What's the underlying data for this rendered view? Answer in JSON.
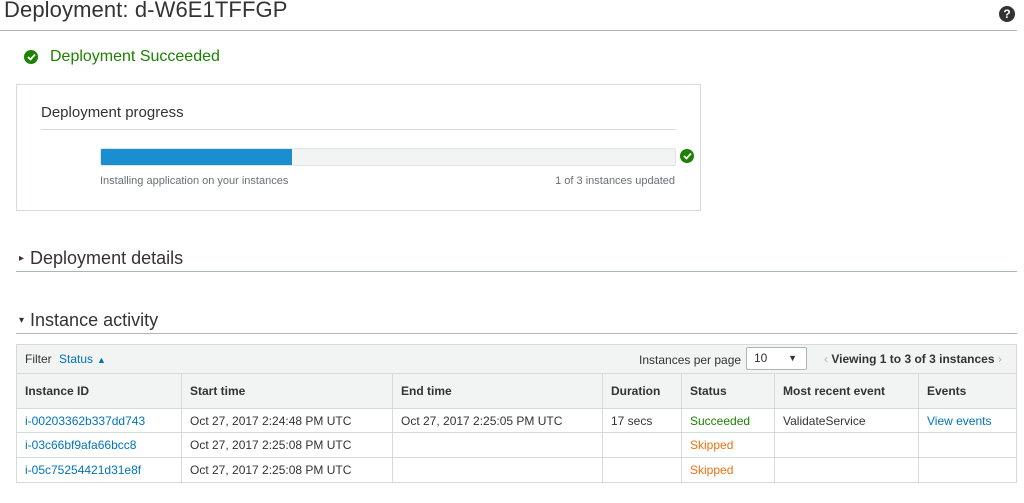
{
  "page": {
    "title": "Deployment: d-W6E1TFFGP",
    "help_icon": "?"
  },
  "status_banner": {
    "text": "Deployment Succeeded",
    "icon": "check-circle-icon",
    "color": "#1d8102"
  },
  "progress": {
    "title": "Deployment progress",
    "fraction": 0.333,
    "caption_left": "Installing application on your instances",
    "caption_right": "1 of 3 instances updated",
    "bar_color": "#1b8ed1"
  },
  "sections": {
    "details": {
      "caret": "▸",
      "label": "Deployment details"
    },
    "activity": {
      "caret": "▾",
      "label": "Instance activity"
    }
  },
  "filter": {
    "label": "Filter",
    "link": "Status",
    "chevron": "▲"
  },
  "pagination": {
    "per_page_label": "Instances per page",
    "per_page_value": "10",
    "prev": "‹",
    "viewing": "Viewing 1 to 3 of 3 instances",
    "next": "›"
  },
  "table": {
    "headers": [
      "Instance ID",
      "Start time",
      "End time",
      "Duration",
      "Status",
      "Most recent event",
      "Events"
    ],
    "rows": [
      [
        "i-00203362b337dd743",
        "Oct 27, 2017 2:24:48 PM UTC",
        "Oct 27, 2017 2:25:05 PM UTC",
        "17 secs",
        "Succeeded",
        "ValidateService",
        "View events"
      ],
      [
        "i-03c66bf9afa66bcc8",
        "Oct 27, 2017 2:25:08 PM UTC",
        "",
        "",
        "Skipped",
        "",
        ""
      ],
      [
        "i-05c75254421d31e8f",
        "Oct 27, 2017 2:25:08 PM UTC",
        "",
        "",
        "Skipped",
        "",
        ""
      ]
    ]
  },
  "colors": {
    "link": "#0073bb",
    "success": "#1d8102",
    "skipped": "#ec7211"
  }
}
